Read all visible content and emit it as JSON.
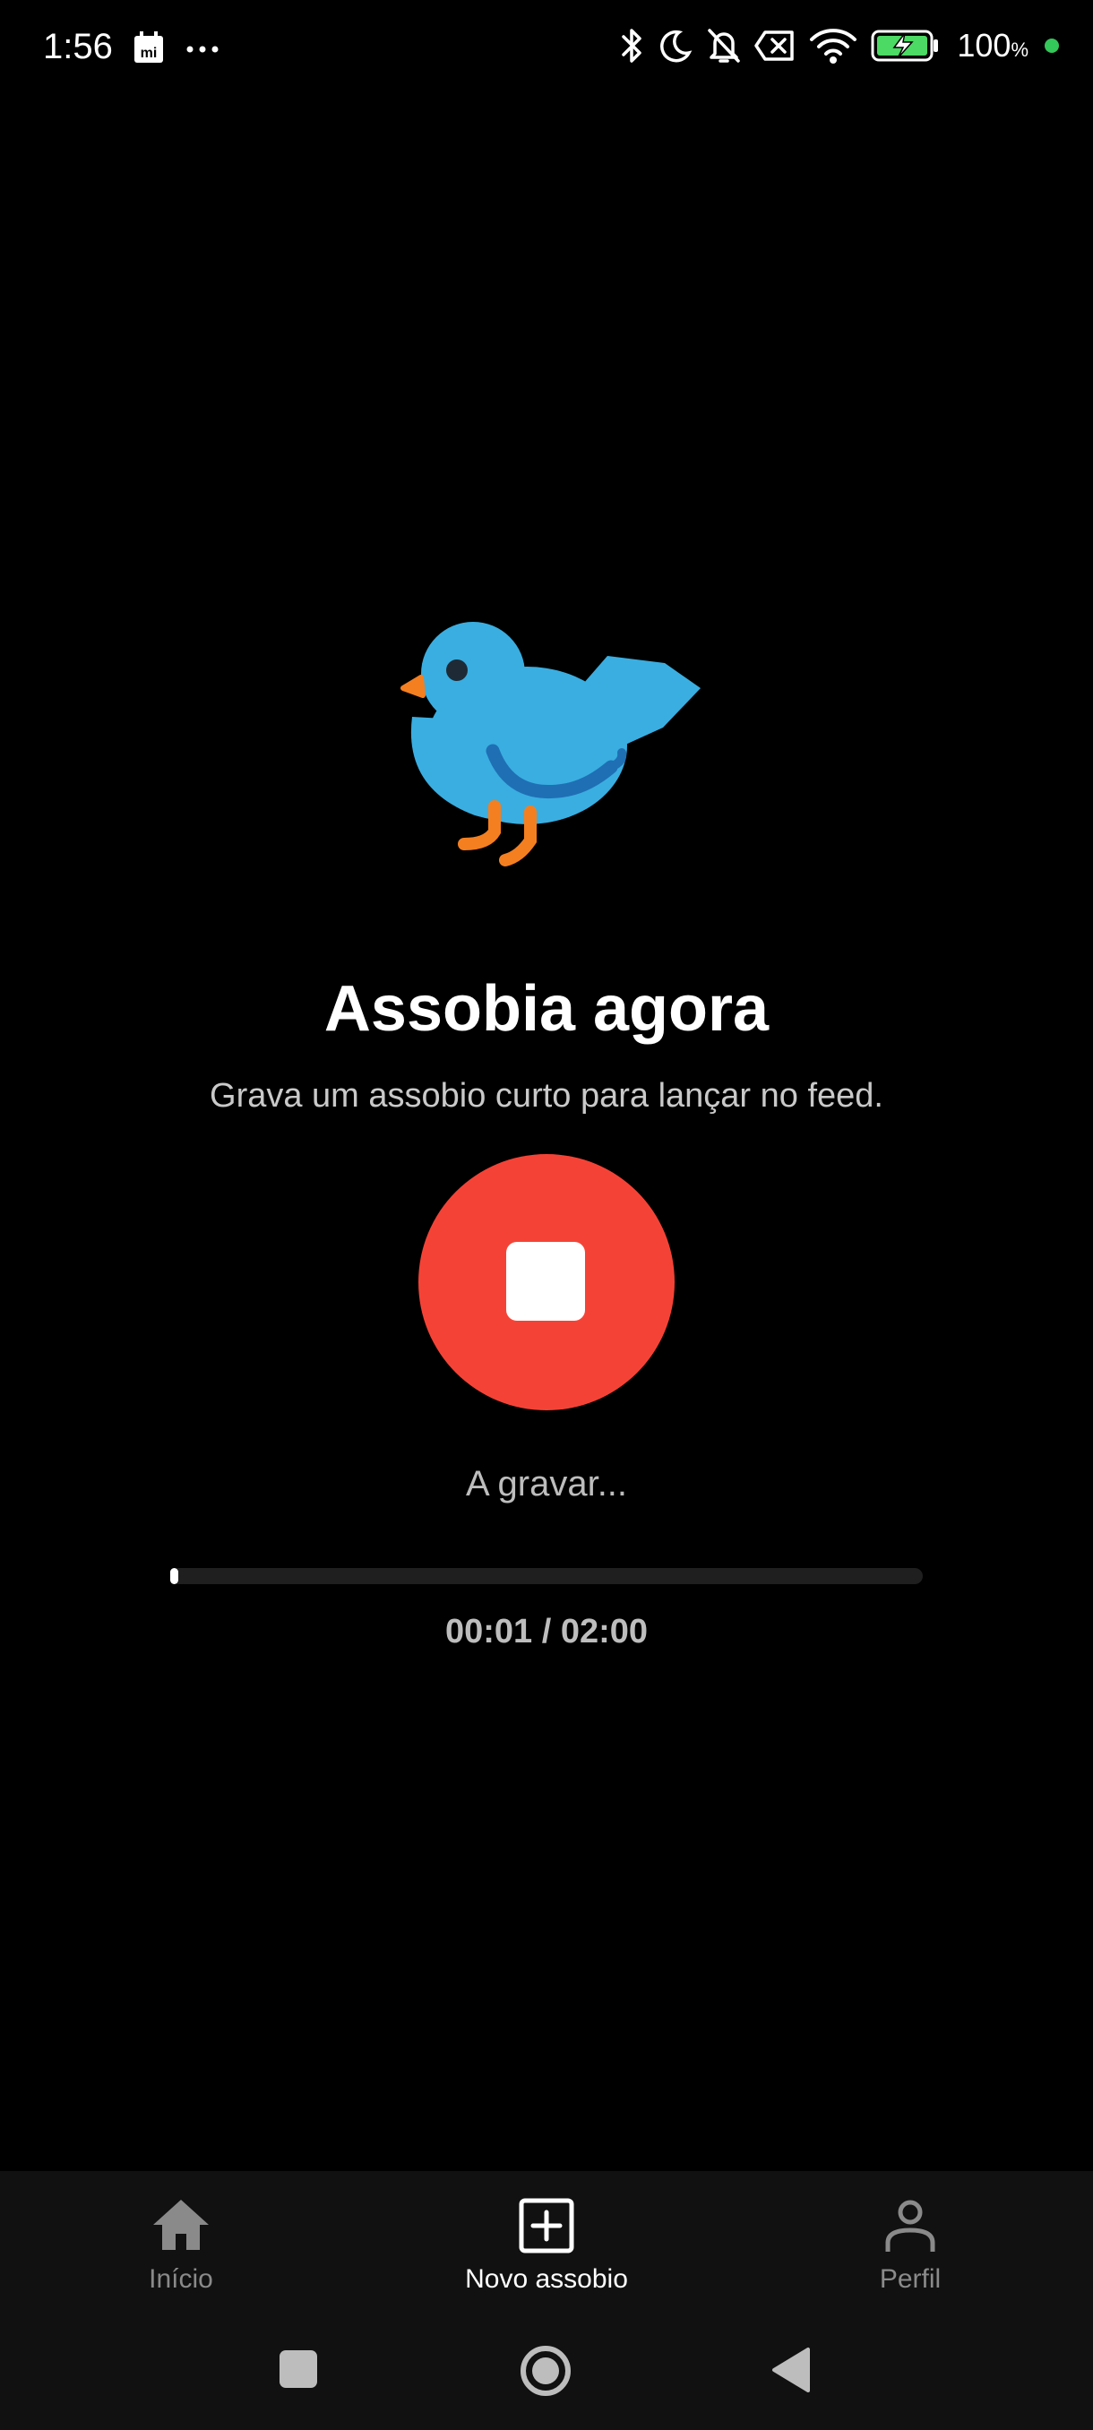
{
  "status_bar": {
    "time": "1:56",
    "battery_text": "100",
    "battery_unit": "%",
    "battery_level": 1.0,
    "icons": [
      "mi-calendar-icon",
      "more-dots-icon",
      "bluetooth-icon",
      "moon-icon",
      "bell-off-icon",
      "no-sim-icon",
      "wifi-icon",
      "battery-charging-icon"
    ]
  },
  "main": {
    "illustration": "bird",
    "title": "Assobia agora",
    "subtitle": "Grava um assobio curto para lançar no feed.",
    "record_button_icon": "stop-icon",
    "status": "A gravar...",
    "progress_fraction": 0.0083,
    "timer": "00:01 / 02:00"
  },
  "bottom_nav": {
    "items": [
      {
        "label": "Início",
        "icon": "home-icon",
        "active": false
      },
      {
        "label": "Novo assobio",
        "icon": "add-box-icon",
        "active": true
      },
      {
        "label": "Perfil",
        "icon": "person-icon",
        "active": false
      }
    ]
  },
  "system_nav": {
    "buttons": [
      "recents-icon",
      "home-circle-icon",
      "back-icon"
    ]
  },
  "colors": {
    "background": "#000000",
    "record_red": "#f44336",
    "nav_background": "#111111",
    "inactive": "#8a8a8a",
    "bird_blue": "#3aaee0",
    "bird_orange": "#f47f20",
    "status_green": "#34c759"
  }
}
